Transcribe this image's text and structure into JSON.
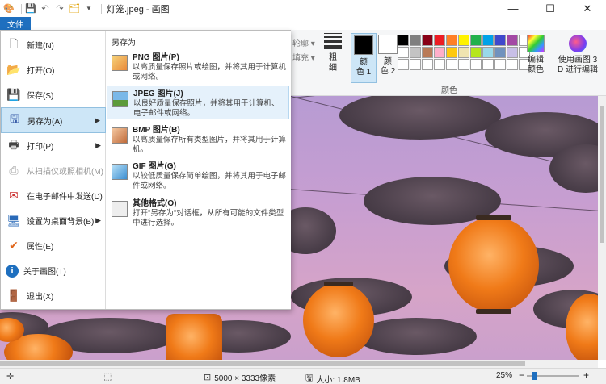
{
  "window": {
    "title": "灯笼.jpeg - 画图",
    "minimize": "—",
    "maximize": "☐",
    "close": "✕"
  },
  "quick_access": [
    "save-icon",
    "undo-icon",
    "redo-icon",
    "customize-icon"
  ],
  "file_tab": {
    "label": "文件"
  },
  "ribbon": {
    "outline_label": "轮廓",
    "fill_label": "填充",
    "thickness_label": "粗\n细",
    "color1_label": "颜\n色 1",
    "color2_label": "颜\n色 2",
    "colors_group_label": "颜色",
    "edit_colors_label": "编辑\n颜色",
    "paint3d_label": "使用画图 3\nD 进行编辑",
    "color1": "#000000",
    "color2": "#ffffff",
    "palette": [
      "#000000",
      "#7f7f7f",
      "#880015",
      "#ed1c24",
      "#ff7f27",
      "#fff200",
      "#22b14c",
      "#00a2e8",
      "#3f48cc",
      "#a349a4",
      "#ffffff",
      "#ffffff",
      "#c3c3c3",
      "#b97a57",
      "#ffaec9",
      "#ffc90e",
      "#efe4b0",
      "#b5e61d",
      "#99d9ea",
      "#7092be",
      "#c8bfe7",
      "#ffffff",
      "#ffffff",
      "#ffffff",
      "#ffffff",
      "#ffffff",
      "#ffffff",
      "#ffffff",
      "#ffffff",
      "#ffffff",
      "#ffffff",
      "#ffffff",
      "#ffffff"
    ]
  },
  "file_menu": {
    "items": [
      {
        "label": "新建(N)",
        "icon": "new-icon"
      },
      {
        "label": "打开(O)",
        "icon": "open-folder-icon"
      },
      {
        "label": "保存(S)",
        "icon": "save-icon"
      },
      {
        "label": "另存为(A)",
        "icon": "save-as-icon",
        "has_submenu": true,
        "highlighted": true
      },
      {
        "label": "打印(P)",
        "icon": "printer-icon",
        "has_submenu": true
      },
      {
        "label": "从扫描仪或照相机(M)",
        "icon": "scanner-icon",
        "disabled": true
      },
      {
        "label": "在电子邮件中发送(D)",
        "icon": "email-icon"
      },
      {
        "label": "设置为桌面背景(B)",
        "icon": "desktop-icon",
        "has_submenu": true
      },
      {
        "label": "属性(E)",
        "icon": "checkmark-icon"
      },
      {
        "label": "关于画图(T)",
        "icon": "info-icon"
      },
      {
        "label": "退出(X)",
        "icon": "exit-icon"
      }
    ],
    "save_as": {
      "heading": "另存为",
      "options": [
        {
          "title": "PNG 图片(P)",
          "desc": "以高质量保存照片或绘图，并将其用于计算机或网络。"
        },
        {
          "title": "JPEG 图片(J)",
          "desc": "以良好质量保存照片，并将其用于计算机、电子邮件或网络。",
          "highlighted": true
        },
        {
          "title": "BMP 图片(B)",
          "desc": "以高质量保存所有类型图片，并将其用于计算机。"
        },
        {
          "title": "GIF 图片(G)",
          "desc": "以较低质量保存简单绘图，并将其用于电子邮件或网络。"
        },
        {
          "title": "其他格式(O)",
          "desc": "打开\"另存为\"对话框，从所有可能的文件类型中进行选择。"
        }
      ]
    }
  },
  "status": {
    "dimensions": "5000 × 3333像素",
    "size": "大小: 1.8MB",
    "zoom": "25%",
    "zoom_out": "−",
    "zoom_in": "+"
  }
}
